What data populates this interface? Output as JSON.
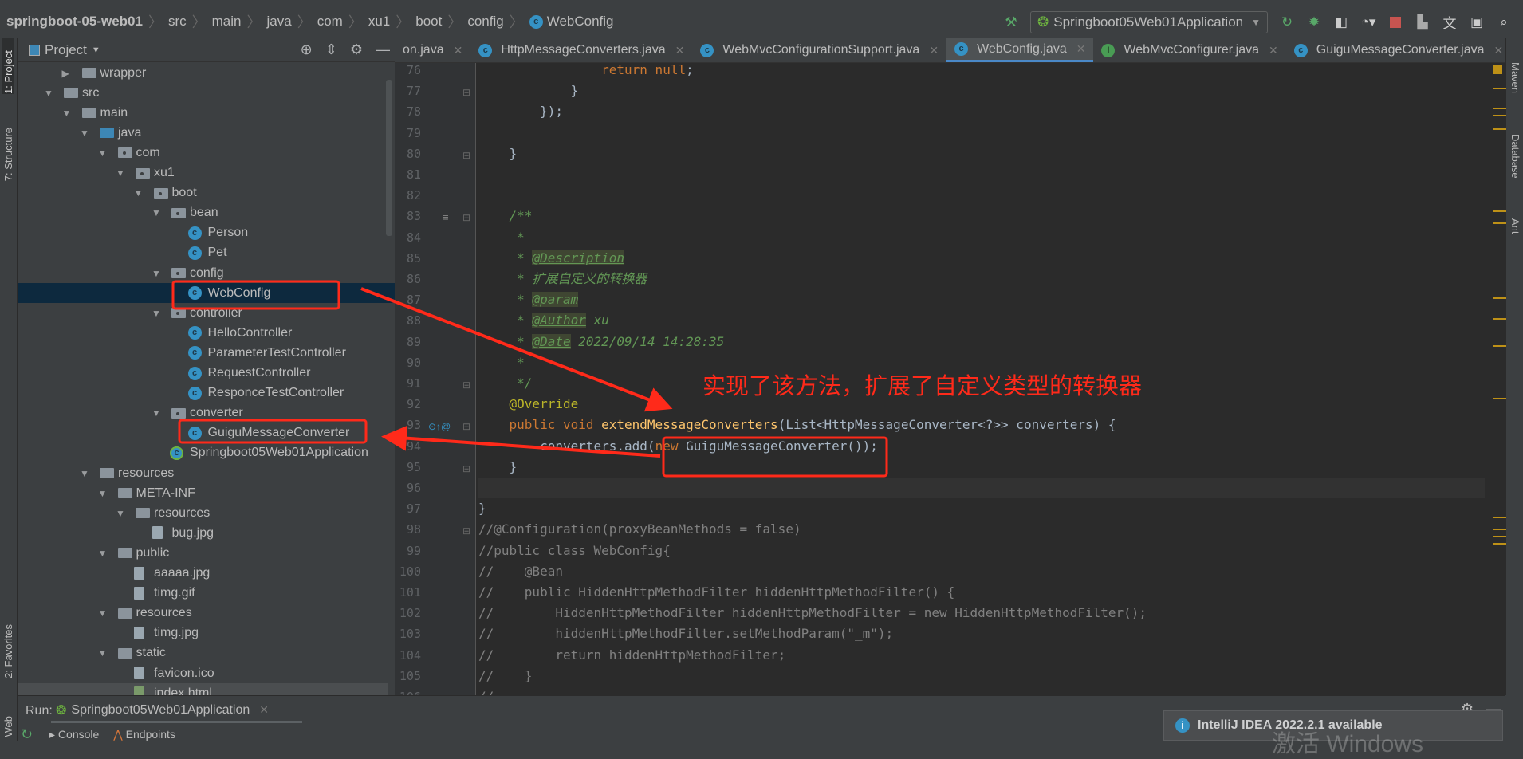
{
  "breadcrumb": [
    "springboot-05-web01",
    "src",
    "main",
    "java",
    "com",
    "xu1",
    "boot",
    "config",
    "WebConfig"
  ],
  "toolbar": {
    "run_config": "Springboot05Web01Application",
    "icons": [
      "hammer-icon",
      "rerun-icon",
      "debug-icon",
      "coverage-icon",
      "profile-icon",
      "stop-icon",
      "project-structure-icon",
      "translate-icon",
      "terminal-icon",
      "search-icon"
    ]
  },
  "left_stripe": {
    "project": "1: Project",
    "structure": "7: Structure",
    "favorites": "2: Favorites",
    "web": "Web"
  },
  "right_stripe": {
    "maven": "Maven",
    "database": "Database",
    "ant": "Ant"
  },
  "project_panel": {
    "title": "Project"
  },
  "tree": [
    {
      "label": "wrapper",
      "level": 1,
      "type": "folder",
      "expanded": false
    },
    {
      "label": "src",
      "level": 0,
      "type": "folder",
      "expanded": true
    },
    {
      "label": "main",
      "level": 1,
      "type": "folder",
      "expanded": true
    },
    {
      "label": "java",
      "level": 2,
      "type": "source-folder",
      "expanded": true
    },
    {
      "label": "com",
      "level": 3,
      "type": "package",
      "expanded": true
    },
    {
      "label": "xu1",
      "level": 4,
      "type": "package",
      "expanded": true
    },
    {
      "label": "boot",
      "level": 5,
      "type": "package",
      "expanded": true
    },
    {
      "label": "bean",
      "level": 6,
      "type": "package",
      "expanded": true
    },
    {
      "label": "Person",
      "level": 7,
      "type": "class"
    },
    {
      "label": "Pet",
      "level": 7,
      "type": "class"
    },
    {
      "label": "config",
      "level": 6,
      "type": "package",
      "expanded": true
    },
    {
      "label": "WebConfig",
      "level": 7,
      "type": "class",
      "selected": true
    },
    {
      "label": "controller",
      "level": 6,
      "type": "package",
      "expanded": true
    },
    {
      "label": "HelloController",
      "level": 7,
      "type": "class"
    },
    {
      "label": "ParameterTestController",
      "level": 7,
      "type": "class"
    },
    {
      "label": "RequestController",
      "level": 7,
      "type": "class"
    },
    {
      "label": "ResponceTestController",
      "level": 7,
      "type": "class"
    },
    {
      "label": "converter",
      "level": 6,
      "type": "package",
      "expanded": true
    },
    {
      "label": "GuiguMessageConverter",
      "level": 7,
      "type": "class"
    },
    {
      "label": "Springboot05Web01Application",
      "level": 6,
      "type": "spring-class"
    },
    {
      "label": "resources",
      "level": 2,
      "type": "resources-folder",
      "expanded": true
    },
    {
      "label": "META-INF",
      "level": 3,
      "type": "folder",
      "expanded": true
    },
    {
      "label": "resources",
      "level": 4,
      "type": "folder",
      "expanded": true
    },
    {
      "label": "bug.jpg",
      "level": 5,
      "type": "image"
    },
    {
      "label": "public",
      "level": 3,
      "type": "folder",
      "expanded": true
    },
    {
      "label": "aaaaa.jpg",
      "level": 4,
      "type": "image"
    },
    {
      "label": "timg.gif",
      "level": 4,
      "type": "image"
    },
    {
      "label": "resources",
      "level": 3,
      "type": "folder",
      "expanded": true
    },
    {
      "label": "timg.jpg",
      "level": 4,
      "type": "image"
    },
    {
      "label": "static",
      "level": 3,
      "type": "folder",
      "expanded": true
    },
    {
      "label": "favicon.ico",
      "level": 4,
      "type": "image"
    },
    {
      "label": "index.html",
      "level": 4,
      "type": "html",
      "hover": true
    }
  ],
  "tabs": [
    {
      "label": "on.java",
      "icon": "none"
    },
    {
      "label": "HttpMessageConverters.java",
      "icon": "class"
    },
    {
      "label": "WebMvcConfigurationSupport.java",
      "icon": "class"
    },
    {
      "label": "WebConfig.java",
      "icon": "class",
      "active": true
    },
    {
      "label": "WebMvcConfigurer.java",
      "icon": "interface"
    },
    {
      "label": "GuiguMessageConverter.java",
      "icon": "class"
    }
  ],
  "code": [
    {
      "n": "76",
      "t": [
        [
          "",
          "                "
        ],
        [
          "kw",
          "return null"
        ],
        [
          "",
          "; "
        ]
      ]
    },
    {
      "n": "77",
      "t": [
        [
          "",
          "            }"
        ]
      ]
    },
    {
      "n": "78",
      "t": [
        [
          "",
          "        });"
        ]
      ]
    },
    {
      "n": "79",
      "t": []
    },
    {
      "n": "80",
      "t": [
        [
          "",
          "    }"
        ]
      ]
    },
    {
      "n": "81",
      "t": []
    },
    {
      "n": "82",
      "t": []
    },
    {
      "n": "83",
      "t": [
        [
          "dc",
          "    /**"
        ]
      ]
    },
    {
      "n": "84",
      "t": [
        [
          "dc",
          "     *"
        ]
      ]
    },
    {
      "n": "85",
      "t": [
        [
          "dc",
          "     * "
        ],
        [
          "dt",
          "@Description"
        ]
      ]
    },
    {
      "n": "86",
      "t": [
        [
          "dc",
          "     * 扩展自定义的转换器"
        ]
      ]
    },
    {
      "n": "87",
      "t": [
        [
          "dc",
          "     * "
        ],
        [
          "dt",
          "@param"
        ]
      ]
    },
    {
      "n": "88",
      "t": [
        [
          "dc",
          "     * "
        ],
        [
          "dt",
          "@Author"
        ],
        [
          "dc",
          " xu"
        ]
      ]
    },
    {
      "n": "89",
      "t": [
        [
          "dc",
          "     * "
        ],
        [
          "dt",
          "@Date"
        ],
        [
          "dc",
          " 2022/09/14 14:28:35"
        ]
      ]
    },
    {
      "n": "90",
      "t": [
        [
          "dc",
          "     *"
        ]
      ]
    },
    {
      "n": "91",
      "t": [
        [
          "dc",
          "     */"
        ]
      ]
    },
    {
      "n": "92",
      "t": [
        [
          "an",
          "    @Override"
        ]
      ]
    },
    {
      "n": "93",
      "t": [
        [
          "kw",
          "    public void "
        ],
        [
          "fn",
          "extendMessageConverters"
        ],
        [
          "",
          "(List<HttpMessageConverter<?>> converters) {"
        ]
      ]
    },
    {
      "n": "94",
      "t": [
        [
          "",
          "        converters.add("
        ],
        [
          "kw",
          "new "
        ],
        [
          "",
          "GuiguMessageConverter());"
        ]
      ]
    },
    {
      "n": "95",
      "t": [
        [
          "",
          "    }"
        ]
      ]
    },
    {
      "n": "96",
      "t": [],
      "current": true
    },
    {
      "n": "97",
      "t": [
        [
          "",
          "}"
        ]
      ]
    },
    {
      "n": "98",
      "t": [
        [
          "cm",
          "//@Configuration(proxyBeanMethods = false)"
        ]
      ]
    },
    {
      "n": "99",
      "t": [
        [
          "cm",
          "//public class WebConfig{"
        ]
      ]
    },
    {
      "n": "100",
      "t": [
        [
          "cm",
          "//    @Bean"
        ]
      ]
    },
    {
      "n": "101",
      "t": [
        [
          "cm",
          "//    public HiddenHttpMethodFilter hiddenHttpMethodFilter() {"
        ]
      ]
    },
    {
      "n": "102",
      "t": [
        [
          "cm",
          "//        HiddenHttpMethodFilter hiddenHttpMethodFilter = new HiddenHttpMethodFilter();"
        ]
      ]
    },
    {
      "n": "103",
      "t": [
        [
          "cm",
          "//        hiddenHttpMethodFilter.setMethodParam(\"_m\");"
        ]
      ]
    },
    {
      "n": "104",
      "t": [
        [
          "cm",
          "//        return hiddenHttpMethodFilter;"
        ]
      ]
    },
    {
      "n": "105",
      "t": [
        [
          "cm",
          "//    }"
        ]
      ]
    },
    {
      "n": "106",
      "t": [
        [
          "cm",
          "//"
        ]
      ]
    }
  ],
  "run_panel": {
    "label": "Run:",
    "tab": "Springboot05Web01Application",
    "console": "Console",
    "endpoints": "Endpoints"
  },
  "notification": {
    "text": "IntelliJ IDEA 2022.2.1 available"
  },
  "watermark": "激活 Windows",
  "annotation": {
    "text": "实现了该方法，扩展了自定义类型的转换器",
    "color": "#ff2a1a"
  },
  "colors": {
    "editor_bg": "#2b2b2b",
    "panel_bg": "#3c3f41",
    "selection": "#0d293e",
    "keyword": "#cc7832",
    "method": "#ffc66d",
    "annotation": "#bbb529",
    "doc_comment": "#629755"
  }
}
